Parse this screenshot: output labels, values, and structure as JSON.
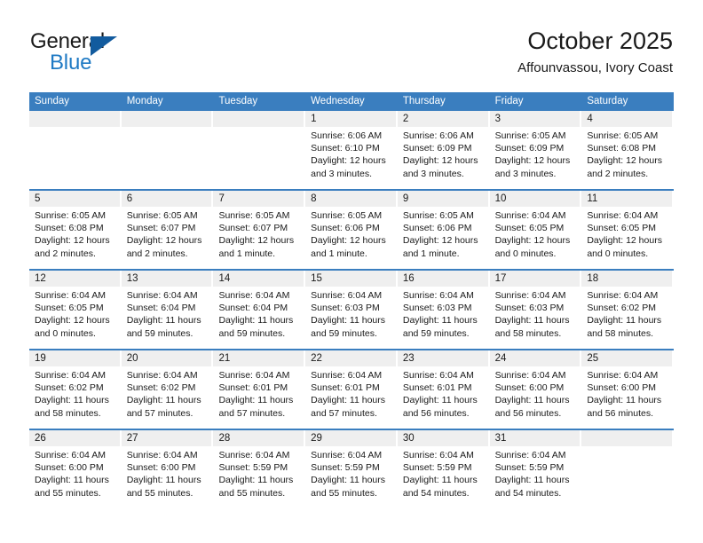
{
  "logo": {
    "text_primary": "General",
    "text_secondary": "Blue",
    "icon": "triangle-logo-icon",
    "color_primary": "#1a1a1a",
    "color_secondary": "#1f7ac4",
    "color_triangle": "#125b9e"
  },
  "header": {
    "title": "October 2025",
    "subtitle": "Affounvassou, Ivory Coast"
  },
  "theme": {
    "header_blue": "#3a7ebf",
    "day_band_gray": "#efefef",
    "text": "#1a1a1a"
  },
  "weekdays": [
    "Sunday",
    "Monday",
    "Tuesday",
    "Wednesday",
    "Thursday",
    "Friday",
    "Saturday"
  ],
  "weeks": [
    [
      {
        "day": "",
        "sunrise": "",
        "sunset": "",
        "daylight_line1": "",
        "daylight_line2": ""
      },
      {
        "day": "",
        "sunrise": "",
        "sunset": "",
        "daylight_line1": "",
        "daylight_line2": ""
      },
      {
        "day": "",
        "sunrise": "",
        "sunset": "",
        "daylight_line1": "",
        "daylight_line2": ""
      },
      {
        "day": "1",
        "sunrise": "Sunrise: 6:06 AM",
        "sunset": "Sunset: 6:10 PM",
        "daylight_line1": "Daylight: 12 hours",
        "daylight_line2": "and 3 minutes."
      },
      {
        "day": "2",
        "sunrise": "Sunrise: 6:06 AM",
        "sunset": "Sunset: 6:09 PM",
        "daylight_line1": "Daylight: 12 hours",
        "daylight_line2": "and 3 minutes."
      },
      {
        "day": "3",
        "sunrise": "Sunrise: 6:05 AM",
        "sunset": "Sunset: 6:09 PM",
        "daylight_line1": "Daylight: 12 hours",
        "daylight_line2": "and 3 minutes."
      },
      {
        "day": "4",
        "sunrise": "Sunrise: 6:05 AM",
        "sunset": "Sunset: 6:08 PM",
        "daylight_line1": "Daylight: 12 hours",
        "daylight_line2": "and 2 minutes."
      }
    ],
    [
      {
        "day": "5",
        "sunrise": "Sunrise: 6:05 AM",
        "sunset": "Sunset: 6:08 PM",
        "daylight_line1": "Daylight: 12 hours",
        "daylight_line2": "and 2 minutes."
      },
      {
        "day": "6",
        "sunrise": "Sunrise: 6:05 AM",
        "sunset": "Sunset: 6:07 PM",
        "daylight_line1": "Daylight: 12 hours",
        "daylight_line2": "and 2 minutes."
      },
      {
        "day": "7",
        "sunrise": "Sunrise: 6:05 AM",
        "sunset": "Sunset: 6:07 PM",
        "daylight_line1": "Daylight: 12 hours",
        "daylight_line2": "and 1 minute."
      },
      {
        "day": "8",
        "sunrise": "Sunrise: 6:05 AM",
        "sunset": "Sunset: 6:06 PM",
        "daylight_line1": "Daylight: 12 hours",
        "daylight_line2": "and 1 minute."
      },
      {
        "day": "9",
        "sunrise": "Sunrise: 6:05 AM",
        "sunset": "Sunset: 6:06 PM",
        "daylight_line1": "Daylight: 12 hours",
        "daylight_line2": "and 1 minute."
      },
      {
        "day": "10",
        "sunrise": "Sunrise: 6:04 AM",
        "sunset": "Sunset: 6:05 PM",
        "daylight_line1": "Daylight: 12 hours",
        "daylight_line2": "and 0 minutes."
      },
      {
        "day": "11",
        "sunrise": "Sunrise: 6:04 AM",
        "sunset": "Sunset: 6:05 PM",
        "daylight_line1": "Daylight: 12 hours",
        "daylight_line2": "and 0 minutes."
      }
    ],
    [
      {
        "day": "12",
        "sunrise": "Sunrise: 6:04 AM",
        "sunset": "Sunset: 6:05 PM",
        "daylight_line1": "Daylight: 12 hours",
        "daylight_line2": "and 0 minutes."
      },
      {
        "day": "13",
        "sunrise": "Sunrise: 6:04 AM",
        "sunset": "Sunset: 6:04 PM",
        "daylight_line1": "Daylight: 11 hours",
        "daylight_line2": "and 59 minutes."
      },
      {
        "day": "14",
        "sunrise": "Sunrise: 6:04 AM",
        "sunset": "Sunset: 6:04 PM",
        "daylight_line1": "Daylight: 11 hours",
        "daylight_line2": "and 59 minutes."
      },
      {
        "day": "15",
        "sunrise": "Sunrise: 6:04 AM",
        "sunset": "Sunset: 6:03 PM",
        "daylight_line1": "Daylight: 11 hours",
        "daylight_line2": "and 59 minutes."
      },
      {
        "day": "16",
        "sunrise": "Sunrise: 6:04 AM",
        "sunset": "Sunset: 6:03 PM",
        "daylight_line1": "Daylight: 11 hours",
        "daylight_line2": "and 59 minutes."
      },
      {
        "day": "17",
        "sunrise": "Sunrise: 6:04 AM",
        "sunset": "Sunset: 6:03 PM",
        "daylight_line1": "Daylight: 11 hours",
        "daylight_line2": "and 58 minutes."
      },
      {
        "day": "18",
        "sunrise": "Sunrise: 6:04 AM",
        "sunset": "Sunset: 6:02 PM",
        "daylight_line1": "Daylight: 11 hours",
        "daylight_line2": "and 58 minutes."
      }
    ],
    [
      {
        "day": "19",
        "sunrise": "Sunrise: 6:04 AM",
        "sunset": "Sunset: 6:02 PM",
        "daylight_line1": "Daylight: 11 hours",
        "daylight_line2": "and 58 minutes."
      },
      {
        "day": "20",
        "sunrise": "Sunrise: 6:04 AM",
        "sunset": "Sunset: 6:02 PM",
        "daylight_line1": "Daylight: 11 hours",
        "daylight_line2": "and 57 minutes."
      },
      {
        "day": "21",
        "sunrise": "Sunrise: 6:04 AM",
        "sunset": "Sunset: 6:01 PM",
        "daylight_line1": "Daylight: 11 hours",
        "daylight_line2": "and 57 minutes."
      },
      {
        "day": "22",
        "sunrise": "Sunrise: 6:04 AM",
        "sunset": "Sunset: 6:01 PM",
        "daylight_line1": "Daylight: 11 hours",
        "daylight_line2": "and 57 minutes."
      },
      {
        "day": "23",
        "sunrise": "Sunrise: 6:04 AM",
        "sunset": "Sunset: 6:01 PM",
        "daylight_line1": "Daylight: 11 hours",
        "daylight_line2": "and 56 minutes."
      },
      {
        "day": "24",
        "sunrise": "Sunrise: 6:04 AM",
        "sunset": "Sunset: 6:00 PM",
        "daylight_line1": "Daylight: 11 hours",
        "daylight_line2": "and 56 minutes."
      },
      {
        "day": "25",
        "sunrise": "Sunrise: 6:04 AM",
        "sunset": "Sunset: 6:00 PM",
        "daylight_line1": "Daylight: 11 hours",
        "daylight_line2": "and 56 minutes."
      }
    ],
    [
      {
        "day": "26",
        "sunrise": "Sunrise: 6:04 AM",
        "sunset": "Sunset: 6:00 PM",
        "daylight_line1": "Daylight: 11 hours",
        "daylight_line2": "and 55 minutes."
      },
      {
        "day": "27",
        "sunrise": "Sunrise: 6:04 AM",
        "sunset": "Sunset: 6:00 PM",
        "daylight_line1": "Daylight: 11 hours",
        "daylight_line2": "and 55 minutes."
      },
      {
        "day": "28",
        "sunrise": "Sunrise: 6:04 AM",
        "sunset": "Sunset: 5:59 PM",
        "daylight_line1": "Daylight: 11 hours",
        "daylight_line2": "and 55 minutes."
      },
      {
        "day": "29",
        "sunrise": "Sunrise: 6:04 AM",
        "sunset": "Sunset: 5:59 PM",
        "daylight_line1": "Daylight: 11 hours",
        "daylight_line2": "and 55 minutes."
      },
      {
        "day": "30",
        "sunrise": "Sunrise: 6:04 AM",
        "sunset": "Sunset: 5:59 PM",
        "daylight_line1": "Daylight: 11 hours",
        "daylight_line2": "and 54 minutes."
      },
      {
        "day": "31",
        "sunrise": "Sunrise: 6:04 AM",
        "sunset": "Sunset: 5:59 PM",
        "daylight_line1": "Daylight: 11 hours",
        "daylight_line2": "and 54 minutes."
      },
      {
        "day": "",
        "sunrise": "",
        "sunset": "",
        "daylight_line1": "",
        "daylight_line2": ""
      }
    ]
  ]
}
